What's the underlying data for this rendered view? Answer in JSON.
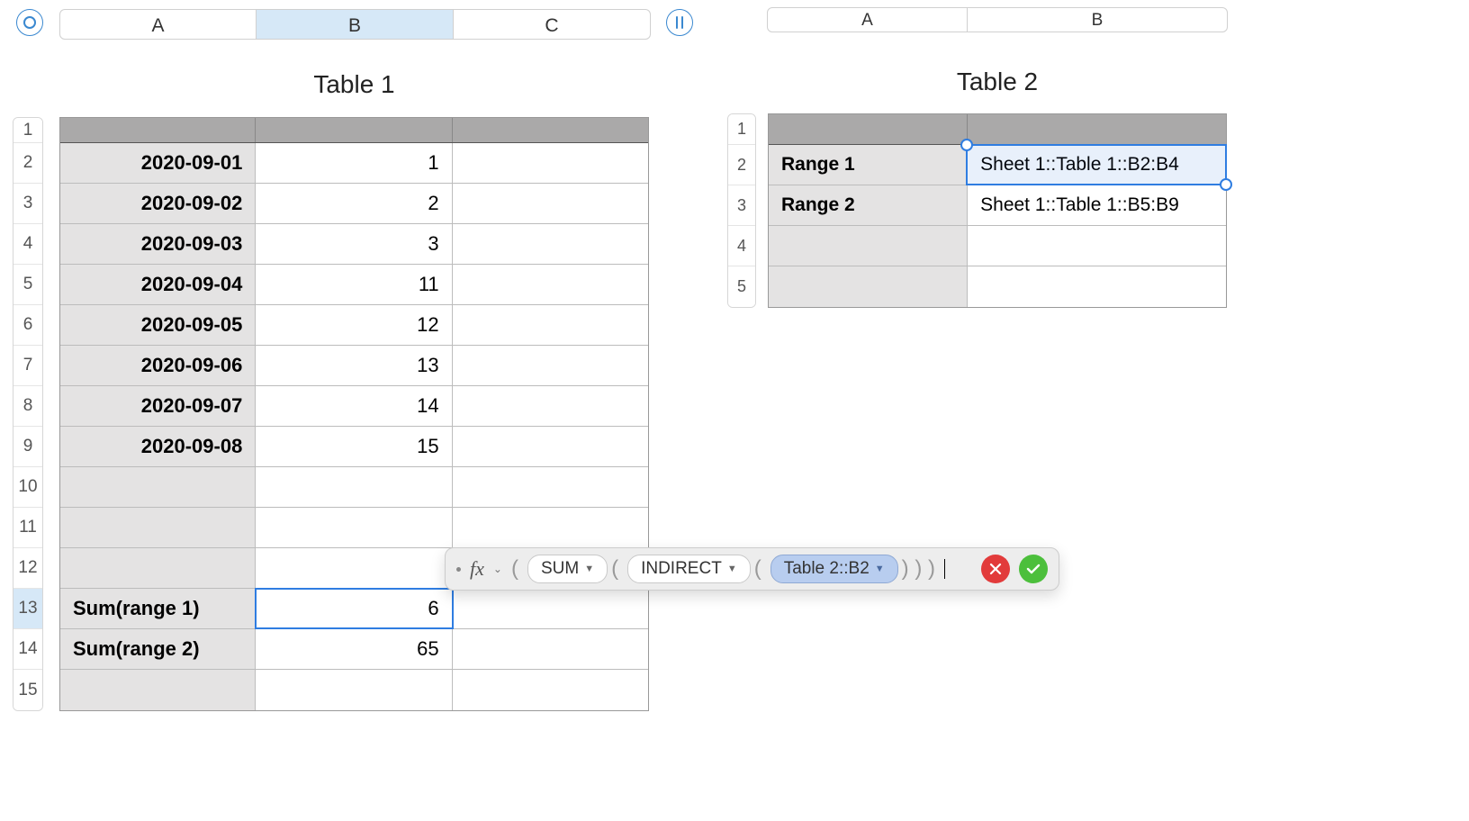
{
  "table1": {
    "title": "Table 1",
    "columns": [
      "A",
      "B",
      "C"
    ],
    "selected_column_idx": 1,
    "row_numbers": [
      "1",
      "2",
      "3",
      "4",
      "5",
      "6",
      "7",
      "8",
      "9",
      "10",
      "11",
      "12",
      "13",
      "14",
      "15"
    ],
    "selected_row_idx": 12,
    "rows": [
      {
        "a": "2020-09-01",
        "b": "1"
      },
      {
        "a": "2020-09-02",
        "b": "2"
      },
      {
        "a": "2020-09-03",
        "b": "3"
      },
      {
        "a": "2020-09-04",
        "b": "11"
      },
      {
        "a": "2020-09-05",
        "b": "12"
      },
      {
        "a": "2020-09-06",
        "b": "13"
      },
      {
        "a": "2020-09-07",
        "b": "14"
      },
      {
        "a": "2020-09-08",
        "b": "15"
      },
      {
        "a": "",
        "b": ""
      },
      {
        "a": "",
        "b": ""
      },
      {
        "a": "",
        "b": ""
      },
      {
        "a": "Sum(range 1)",
        "b": "6",
        "left": true,
        "selected": true
      },
      {
        "a": "Sum(range 2)",
        "b": "65",
        "left": true
      },
      {
        "a": "",
        "b": ""
      }
    ]
  },
  "table2": {
    "title": "Table 2",
    "columns": [
      "A",
      "B"
    ],
    "row_numbers": [
      "1",
      "2",
      "3",
      "4",
      "5"
    ],
    "rows": [
      {
        "a": "Range 1",
        "b": "Sheet 1::Table 1::B2:B4",
        "selected": true
      },
      {
        "a": "Range 2",
        "b": "Sheet 1::Table 1::B5:B9"
      },
      {
        "a": "",
        "b": ""
      },
      {
        "a": "",
        "b": ""
      }
    ]
  },
  "formula_bar": {
    "fx": "fx",
    "token1": "SUM",
    "token2": "INDIRECT",
    "reference": "Table 2::B2"
  },
  "chart_data": {
    "type": "table",
    "tables": [
      {
        "name": "Table 1",
        "columns": [
          "A",
          "B",
          "C"
        ],
        "data": [
          [
            "2020-09-01",
            1,
            null
          ],
          [
            "2020-09-02",
            2,
            null
          ],
          [
            "2020-09-03",
            3,
            null
          ],
          [
            "2020-09-04",
            11,
            null
          ],
          [
            "2020-09-05",
            12,
            null
          ],
          [
            "2020-09-06",
            13,
            null
          ],
          [
            "2020-09-07",
            14,
            null
          ],
          [
            "2020-09-08",
            15,
            null
          ],
          [
            null,
            null,
            null
          ],
          [
            null,
            null,
            null
          ],
          [
            null,
            null,
            null
          ],
          [
            "Sum(range 1)",
            6,
            null
          ],
          [
            "Sum(range 2)",
            65,
            null
          ],
          [
            null,
            null,
            null
          ]
        ]
      },
      {
        "name": "Table 2",
        "columns": [
          "A",
          "B"
        ],
        "data": [
          [
            "Range 1",
            "Sheet 1::Table 1::B2:B4"
          ],
          [
            "Range 2",
            "Sheet 1::Table 1::B5:B9"
          ],
          [
            null,
            null
          ],
          [
            null,
            null
          ]
        ]
      }
    ]
  }
}
